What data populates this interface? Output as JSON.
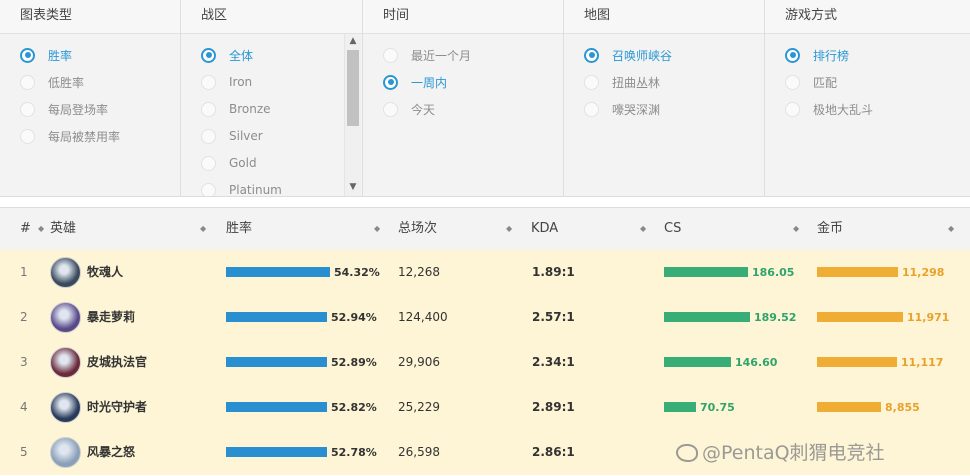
{
  "filters": [
    {
      "title": "图表类型",
      "options": [
        {
          "label": "胜率",
          "selected": true
        },
        {
          "label": "低胜率",
          "selected": false
        },
        {
          "label": "每局登场率",
          "selected": false
        },
        {
          "label": "每局被禁用率",
          "selected": false
        }
      ]
    },
    {
      "title": "战区",
      "options": [
        {
          "label": "全体",
          "selected": true
        },
        {
          "label": "Iron",
          "selected": false
        },
        {
          "label": "Bronze",
          "selected": false
        },
        {
          "label": "Silver",
          "selected": false
        },
        {
          "label": "Gold",
          "selected": false
        },
        {
          "label": "Platinum",
          "selected": false
        }
      ]
    },
    {
      "title": "时间",
      "options": [
        {
          "label": "最近一个月",
          "selected": false
        },
        {
          "label": "一周内",
          "selected": true
        },
        {
          "label": "今天",
          "selected": false
        }
      ]
    },
    {
      "title": "地图",
      "options": [
        {
          "label": "召唤师峡谷",
          "selected": true
        },
        {
          "label": "扭曲丛林",
          "selected": false
        },
        {
          "label": "嚎哭深渊",
          "selected": false
        }
      ]
    },
    {
      "title": "游戏方式",
      "options": [
        {
          "label": "排行榜",
          "selected": true
        },
        {
          "label": "匹配",
          "selected": false
        },
        {
          "label": "极地大乱斗",
          "selected": false
        }
      ]
    }
  ],
  "table": {
    "headers": {
      "rank": "#",
      "hero": "英雄",
      "winrate": "胜率",
      "games": "总场次",
      "kda": "KDA",
      "cs": "CS",
      "gold": "金币"
    },
    "sort_icon": "⇕",
    "rows": [
      {
        "rank": "1",
        "hero": "牧魂人",
        "winrate": "54.32%",
        "winrate_value": 54.32,
        "games": "12,268",
        "kda": "1.89:1",
        "cs": "186.05",
        "cs_value": 186.05,
        "gold": "11,298",
        "gold_value": 11298
      },
      {
        "rank": "2",
        "hero": "暴走萝莉",
        "winrate": "52.94%",
        "winrate_value": 52.94,
        "games": "124,400",
        "kda": "2.57:1",
        "cs": "189.52",
        "cs_value": 189.52,
        "gold": "11,971",
        "gold_value": 11971
      },
      {
        "rank": "3",
        "hero": "皮城执法官",
        "winrate": "52.89%",
        "winrate_value": 52.89,
        "games": "29,906",
        "kda": "2.34:1",
        "cs": "146.60",
        "cs_value": 146.6,
        "gold": "11,117",
        "gold_value": 11117
      },
      {
        "rank": "4",
        "hero": "时光守护者",
        "winrate": "52.82%",
        "winrate_value": 52.82,
        "games": "25,229",
        "kda": "2.89:1",
        "cs": "70.75",
        "cs_value": 70.75,
        "gold": "8,855",
        "gold_value": 8855
      },
      {
        "rank": "5",
        "hero": "风暴之怒",
        "winrate": "52.78%",
        "winrate_value": 52.78,
        "games": "26,598",
        "kda": "2.86:1",
        "cs": "",
        "cs_value": null,
        "gold": "",
        "gold_value": null
      }
    ]
  },
  "colors": {
    "accent": "#2a97d4",
    "winrate_bar": "#2a8fd0",
    "cs_bar": "#38ad76",
    "cs_text": "#2fa46b",
    "gold_bar": "#f0ad35",
    "gold_text": "#e9a12b"
  },
  "icons": {
    "sort": "sort-arrows-icon",
    "scroll_up": "chevron-up-icon",
    "scroll_down": "chevron-down-icon"
  },
  "avatars": [
    "#3a4a5c",
    "#5a4a8a",
    "#6a2a3a",
    "#2a3a5a",
    "#8aa0b8"
  ],
  "watermark": "@PentaQ刺猬电竞社"
}
